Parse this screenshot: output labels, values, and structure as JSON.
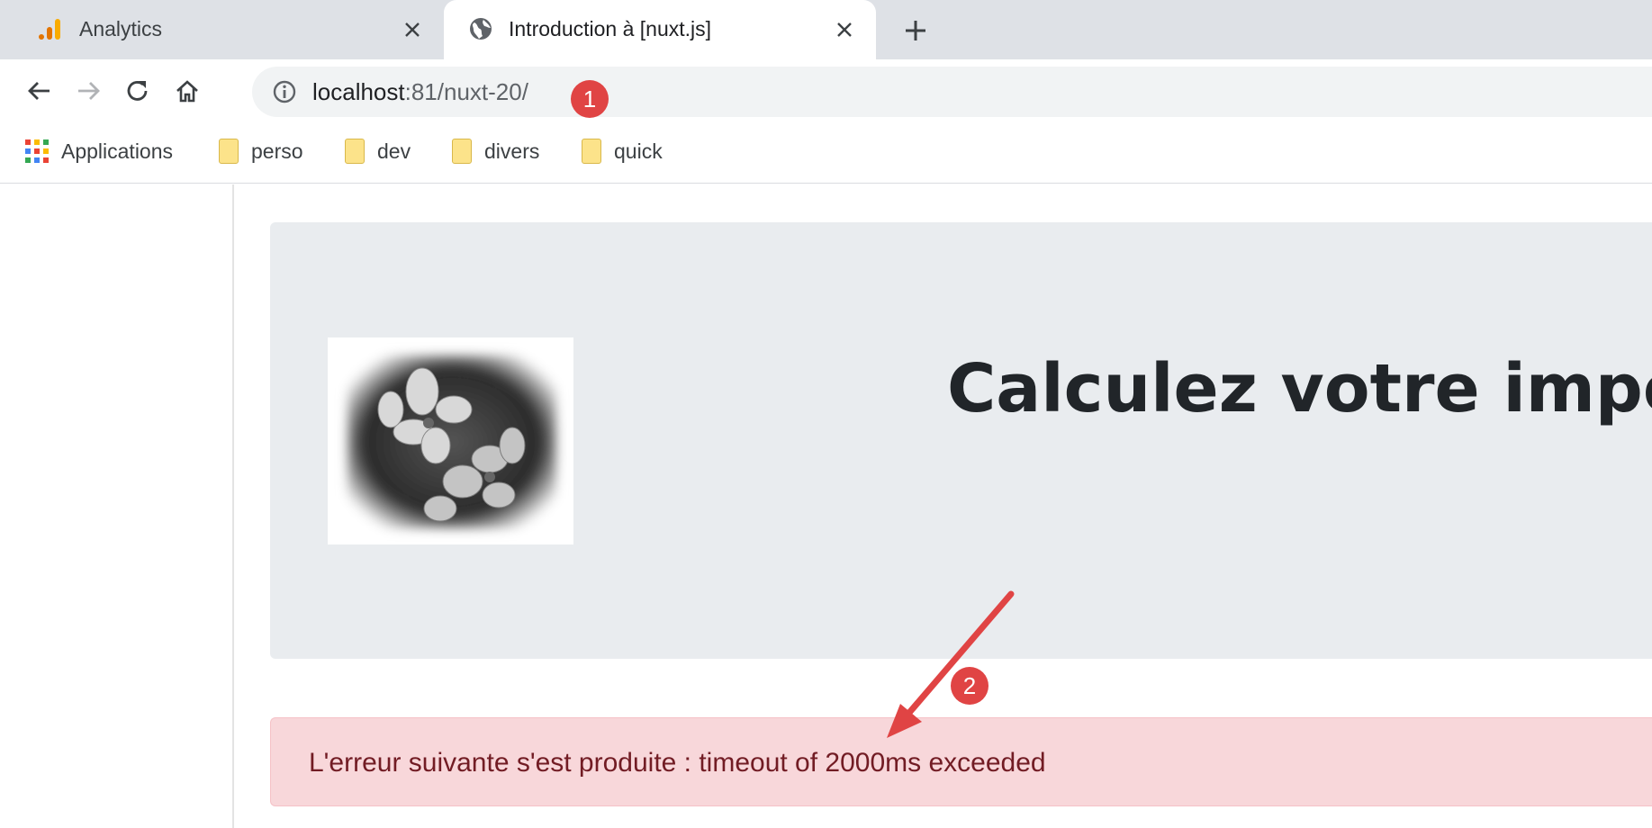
{
  "browser": {
    "tabs": [
      {
        "title": "Analytics",
        "icon": "analytics-icon",
        "active": false
      },
      {
        "title": "Introduction à [nuxt.js]",
        "icon": "globe-icon",
        "active": true
      }
    ],
    "address": {
      "host": "localhost",
      "rest": ":81/nuxt-20/"
    },
    "bookmarks": [
      {
        "label": "Applications",
        "icon": "apps-grid-icon"
      },
      {
        "label": "perso",
        "icon": "folder-icon"
      },
      {
        "label": "dev",
        "icon": "folder-icon"
      },
      {
        "label": "divers",
        "icon": "folder-icon"
      },
      {
        "label": "quick",
        "icon": "folder-icon"
      }
    ]
  },
  "page": {
    "heading": "Calculez votre impôt",
    "image_alt_icon": "flower-photo",
    "error_message": "L'erreur suivante s'est produite : timeout of 2000ms exceeded"
  },
  "annotations": {
    "marker1": "1",
    "marker2": "2",
    "color": "#e04444"
  },
  "colors": {
    "tabstrip": "#dee1e6",
    "jumbotron": "#e9ecef",
    "alert_bg": "#f8d7da",
    "alert_text": "#721c24"
  }
}
